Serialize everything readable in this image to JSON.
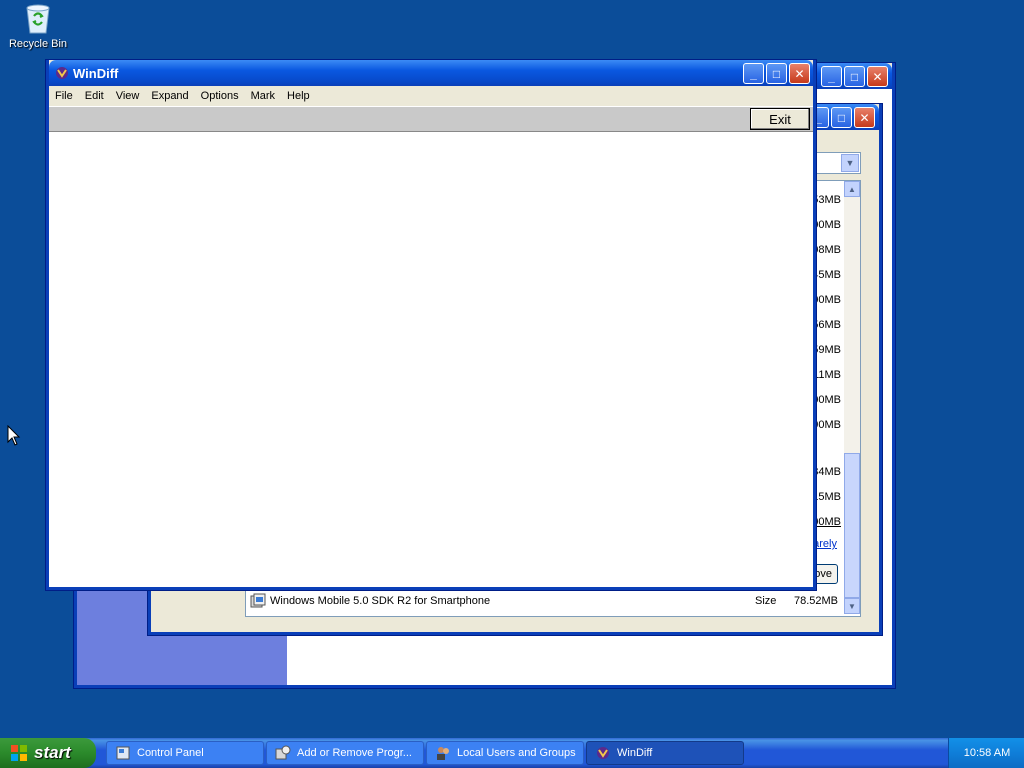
{
  "desktop": {
    "recycle_bin_label": "Recycle Bin"
  },
  "background_window": {
    "sizes": [
      "53MB",
      "00MB",
      "08MB",
      "45MB",
      "00MB",
      "56MB",
      "59MB",
      "11MB",
      "00MB",
      "90MB",
      "84MB",
      "15MB",
      "00MB"
    ],
    "rarely_label": "arely",
    "remove_label": "ove",
    "program_name": "Windows Mobile 5.0 SDK R2 for Smartphone",
    "size_label": "Size",
    "size_value": "78.52MB"
  },
  "windiff": {
    "title": "WinDiff",
    "menu": [
      "File",
      "Edit",
      "View",
      "Expand",
      "Options",
      "Mark",
      "Help"
    ],
    "exit_label": "Exit"
  },
  "taskbar": {
    "start_label": "start",
    "tasks": [
      {
        "label": "Control Panel",
        "icon": "control-panel-icon"
      },
      {
        "label": "Add or Remove Progr...",
        "icon": "add-remove-programs-icon"
      },
      {
        "label": "Local Users and Groups",
        "icon": "users-groups-icon"
      },
      {
        "label": "WinDiff",
        "icon": "windiff-icon"
      }
    ],
    "clock": "10:58 AM"
  },
  "colors": {
    "desktop_bg": "#0b4d99",
    "title_blue": "#0a58e0",
    "start_green": "#2b8a2b"
  }
}
